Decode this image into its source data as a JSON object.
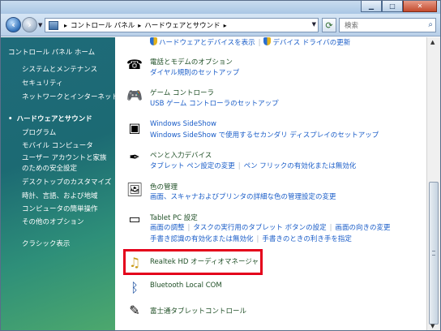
{
  "window": {
    "caption_buttons": [
      "minimize",
      "maximize",
      "close"
    ]
  },
  "address_bar": {
    "breadcrumbs": [
      "コントロール パネル",
      "ハードウェアとサウンド"
    ],
    "search_placeholder": "検索"
  },
  "left_nav": {
    "home": "コントロール パネル ホーム",
    "items": [
      "システムとメンテナンス",
      "セキュリティ",
      "ネットワークとインターネット",
      "ハードウェアとサウンド",
      "プログラム",
      "モバイル コンピュータ",
      "ユーザー アカウントと家族のための安全設定",
      "デスクトップのカスタマイズ",
      "時計、言語、および地域",
      "コンピュータの簡単操作",
      "その他のオプション"
    ],
    "classic": "クラシック表示"
  },
  "content": {
    "top_tasks": [
      "ハードウェアとデバイスを表示",
      "デバイス ドライバの更新"
    ],
    "categories": [
      {
        "title": "電話とモデムのオプション",
        "icon": "phone-modem-icon",
        "tasks": [
          "ダイヤル規則のセットアップ"
        ]
      },
      {
        "title": "ゲーム コントローラ",
        "icon": "game-controller-icon",
        "tasks": [
          "USB ゲーム コントローラのセットアップ"
        ]
      },
      {
        "title": "Windows SideShow",
        "icon": "sideshow-icon",
        "tasks": [
          "Windows SideShow で使用するセカンダリ ディスプレイのセットアップ"
        ]
      },
      {
        "title": "ペンと入力デバイス",
        "icon": "pen-icon",
        "tasks": [
          "タブレット ペン設定の変更",
          "ペン フリックの有効化または無効化"
        ]
      },
      {
        "title": "色の管理",
        "icon": "color-management-icon",
        "tasks": [
          "画面、スキャナおよびプリンタの詳細な色の管理設定の変更"
        ]
      },
      {
        "title": "Tablet PC 設定",
        "icon": "tablet-pc-icon",
        "tasks": [
          "画面の調整",
          "タスクの実行用のタブレット ボタンの設定",
          "画面の向きの変更"
        ],
        "tasks2": [
          "手書き認識の有効化または無効化",
          "手書きのときの利き手を指定"
        ]
      },
      {
        "title": "Realtek HD オーディオマネージャ",
        "icon": "realtek-audio-icon",
        "tasks": []
      },
      {
        "title": "Bluetooth Local COM",
        "icon": "bluetooth-icon",
        "tasks": []
      },
      {
        "title": "富士通タブレットコントロール",
        "icon": "fujitsu-tablet-icon",
        "tasks": []
      }
    ]
  },
  "colors": {
    "highlight_border": "#e4001b",
    "link": "#1a5dc8",
    "category_title": "#1f4f26"
  }
}
